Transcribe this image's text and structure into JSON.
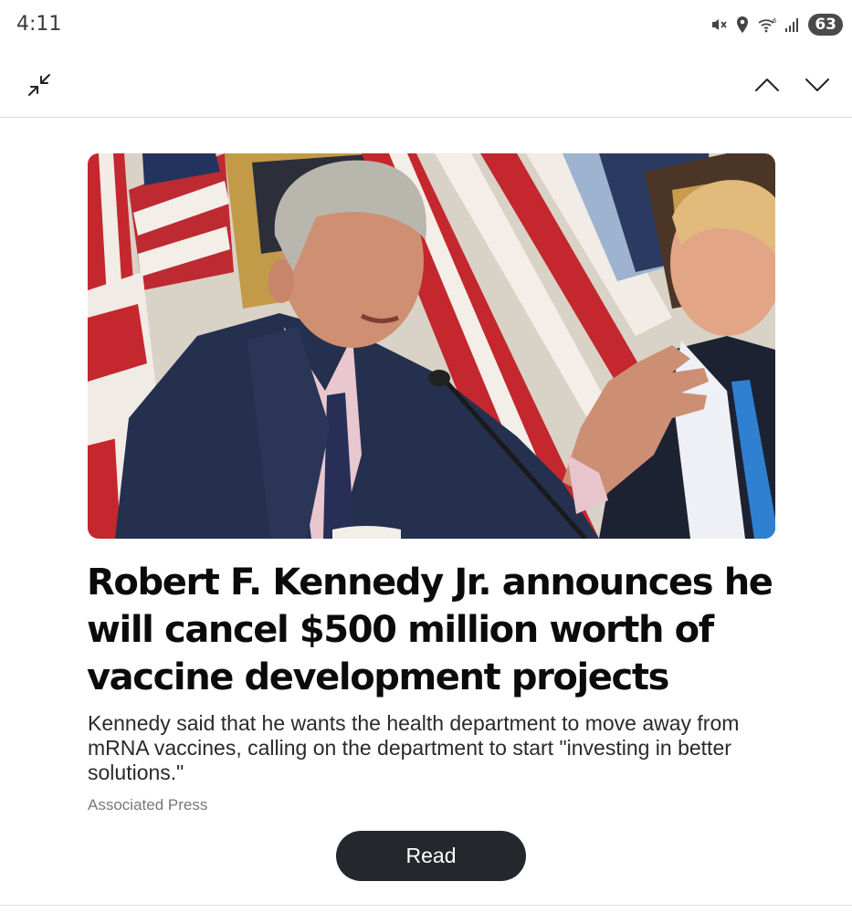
{
  "status_bar": {
    "time": "4:11",
    "battery": "63",
    "icons": [
      "mute-icon",
      "location-icon",
      "wifi-icon",
      "signal-icon",
      "battery-icon"
    ]
  },
  "toolbar": {
    "icons": [
      "collapse-icon",
      "chevron-up-icon",
      "chevron-down-icon"
    ]
  },
  "article": {
    "image": {
      "subject": "man in a navy pinstripe suit speaking at a microphone, a man in a blue tie beside him, flags behind"
    },
    "headline": "Robert F. Kennedy Jr. announces he will cancel $500 million worth of vaccine development projects",
    "summary": "Kennedy said that he wants the health department to move away from mRNA vaccines, calling on the department to start \"investing in better solutions.\"",
    "source": "Associated Press",
    "read_label": "Read"
  },
  "colors": {
    "button_bg": "#24272c",
    "headline": "#0b0b0b",
    "source": "#777777"
  }
}
